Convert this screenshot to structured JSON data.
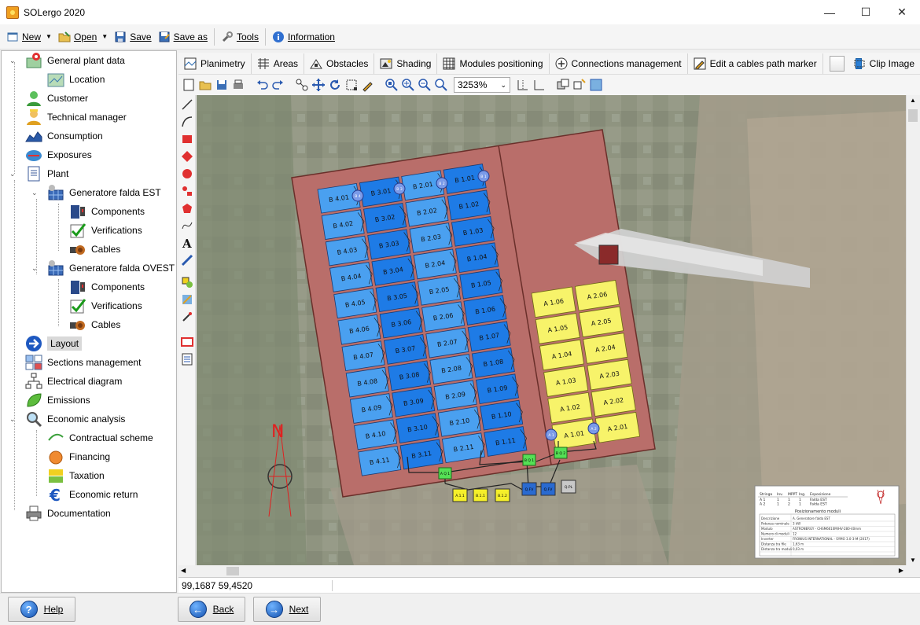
{
  "window": {
    "title": "SOLergo 2020",
    "minimize": "—",
    "maximize": "☐",
    "close": "✕"
  },
  "toolbar": {
    "new_label": "New",
    "open_label": "Open",
    "save_label": "Save",
    "save_as_label": "Save as",
    "tools_label": "Tools",
    "information_label": "Information"
  },
  "tree": {
    "items": [
      {
        "label": "General plant data",
        "icon": "map-pin-icon"
      },
      {
        "label": "Location",
        "icon": "map-icon"
      },
      {
        "label": "Customer",
        "icon": "customer-icon"
      },
      {
        "label": "Technical manager",
        "icon": "technician-icon"
      },
      {
        "label": "Consumption",
        "icon": "consumption-icon"
      },
      {
        "label": "Exposures",
        "icon": "compass-icon"
      },
      {
        "label": "Plant",
        "icon": "document-icon"
      },
      {
        "label": "Generatore falda EST",
        "icon": "solar-panel-icon"
      },
      {
        "label": "Components",
        "icon": "components-icon"
      },
      {
        "label": "Verifications",
        "icon": "checkmark-icon"
      },
      {
        "label": "Cables",
        "icon": "cables-icon"
      },
      {
        "label": "Generatore falda OVEST",
        "icon": "solar-panel-icon"
      },
      {
        "label": "Components",
        "icon": "components-icon"
      },
      {
        "label": "Verifications",
        "icon": "checkmark-icon"
      },
      {
        "label": "Cables",
        "icon": "cables-icon"
      },
      {
        "label": "Layout",
        "icon": "arrow-right-icon"
      },
      {
        "label": "Sections management",
        "icon": "sections-icon"
      },
      {
        "label": "Electrical diagram",
        "icon": "diagram-icon"
      },
      {
        "label": "Emissions",
        "icon": "leaf-icon"
      },
      {
        "label": "Economic analysis",
        "icon": "magnifier-icon"
      },
      {
        "label": "Contractual scheme",
        "icon": "gse-icon"
      },
      {
        "label": "Financing",
        "icon": "piggy-bank-icon"
      },
      {
        "label": "Taxation",
        "icon": "money-icon"
      },
      {
        "label": "Economic return",
        "icon": "euro-icon"
      },
      {
        "label": "Documentation",
        "icon": "printer-icon"
      }
    ]
  },
  "tabs": {
    "planimetry": "Planimetry",
    "areas": "Areas",
    "obstacles": "Obstacles",
    "shading": "Shading",
    "modules_positioning": "Modules positioning",
    "connections_management": "Connections management",
    "edit_cables_path": "Edit a cables path marker",
    "clip_image": "Clip Image"
  },
  "zoom": {
    "value": "3253%",
    "slider_level": 0.45
  },
  "status": {
    "coordinates": "99,1687 59,4520"
  },
  "bottom": {
    "help_label": "Help",
    "back_label": "Back",
    "next_label": "Next"
  },
  "plan": {
    "b_columns": [
      [
        "B 4.01",
        "B 4.02",
        "B 4.03",
        "B 4.04",
        "B 4.05",
        "B 4.06",
        "B 4.07",
        "B 4.08",
        "B 4.09",
        "B 4.10",
        "B 4.11"
      ],
      [
        "B 3.01",
        "B 3.02",
        "B 3.03",
        "B 3.04",
        "B 3.05",
        "B 3.06",
        "B 3.07",
        "B 3.08",
        "B 3.09",
        "B 3.10",
        "B 3.11"
      ],
      [
        "B 2.01",
        "B 2.02",
        "B 2.03",
        "B 2.04",
        "B 2.05",
        "B 2.06",
        "B 2.07",
        "B 2.08",
        "B 2.09",
        "B 2.10",
        "B 2.11"
      ],
      [
        "B 1.01",
        "B 1.02",
        "B 1.03",
        "B 1.04",
        "B 1.05",
        "B 1.06",
        "B 1.07",
        "B 1.08",
        "B 1.09",
        "B 1.10",
        "B 1.11"
      ]
    ],
    "a_columns": [
      [
        "A 1.06",
        "A 1.05",
        "A 1.04",
        "A 1.03",
        "A 1.02",
        "A 1.01"
      ],
      [
        "A 2.06",
        "A 2.05",
        "A 2.04",
        "A 2.03",
        "A 2.02",
        "A 2.01"
      ]
    ],
    "string_markers": [
      "B 4",
      "B 3",
      "B 2",
      "B 1",
      "A 1",
      "A 2"
    ],
    "junctions": [
      "B Q 1",
      "B Q 2",
      "A Q 1"
    ],
    "inverters": [
      "A.1.1",
      "B.1.1",
      "B.1.2",
      "Q.FV",
      "Q.FV",
      "Q.PL"
    ],
    "north_label": "N",
    "legend": {
      "header_cols": [
        "Stringa",
        "Inv.",
        "MPPT",
        "Ing.",
        "Esposizione"
      ],
      "rows": [
        [
          "A 1",
          "1",
          "1",
          "1",
          "Falda EST"
        ],
        [
          "A 2",
          "1",
          "2",
          "1",
          "Falda EST"
        ]
      ],
      "section_title": "Posizionamento moduli",
      "details": [
        [
          "Descrizione",
          "A. Generatore falda EST"
        ],
        [
          "Potenza nominale",
          "3 kW"
        ],
        [
          "Modulo",
          "ASTRONERGY - CHSM6610M/HV-280-40mm"
        ],
        [
          "Numero di moduli",
          "12"
        ],
        [
          "Inverter",
          "FRONIUS INTERNATIONAL - SYMO 3.0-3-M (2017)"
        ],
        [
          "Distanza tra file",
          "1,63 m"
        ],
        [
          "Distanza tra moduli",
          "0,03 m"
        ]
      ]
    }
  },
  "colors": {
    "roof": "#b96e6a",
    "module_b_dark": "#1e7be6",
    "module_b_light": "#4aa0f0",
    "module_a": "#f7f36a",
    "junction_green": "#55e055",
    "inverter_yellow": "#f5ef2a",
    "north_red": "#e02020"
  }
}
